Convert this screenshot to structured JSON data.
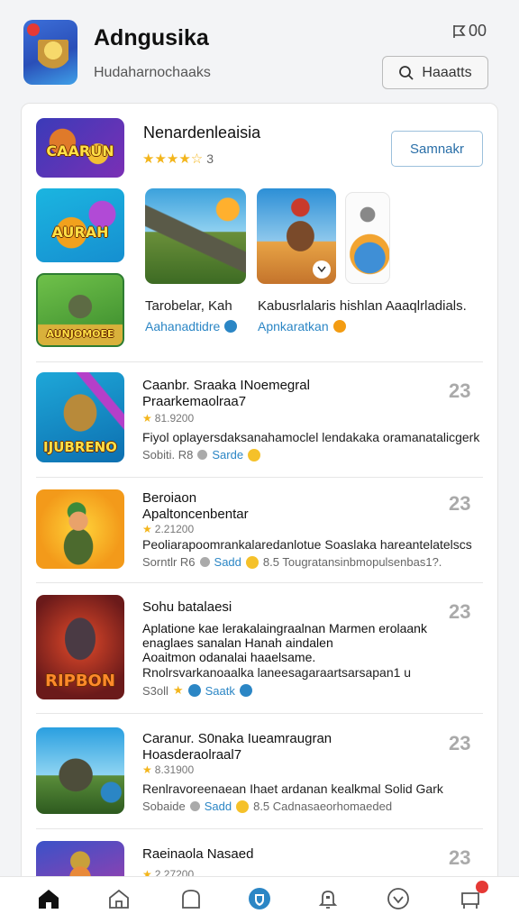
{
  "header": {
    "app_title": "Adngusika",
    "app_subtitle": "Hudaharnochaaks",
    "flag_count": "00",
    "search_label": "Haaatts"
  },
  "featured": {
    "title": "Nenardenleaisia",
    "rating_stars": "★★★★☆",
    "rating_value": "3",
    "action_label": "Samnakr",
    "main_thumb_label": "CAARUN",
    "thumb_a_label": "AURAH",
    "thumb_b_label": "AUNJOMOEE",
    "shot1_caption": "Tarobelar, Kah",
    "shot1_link": "Aahanadtidre",
    "shot2_caption": "Kabusrlalaris hishlan Aaaqlrladials.",
    "shot2_link": "Apnkaratkan"
  },
  "items": [
    {
      "title_line1": "Caanbr. Sraaka INoemegral",
      "title_line2": "Praarkemaolraa7",
      "rating": "81.9200",
      "description": "Fiyol oplayersdaksanahamoclel lendakaka oramanatalicgerk",
      "meta_left": "Sobiti. R8",
      "meta_link": "Sarde",
      "meta_right": "",
      "count": "23",
      "thumb_label": "IJUBRENO"
    },
    {
      "title_line1": "Beroiaon",
      "title_line2": "Apaltoncenbentar",
      "rating": "2.21200",
      "description": "Peoliarapoomrankalaredanlotue Soaslaka hareantelatelscs",
      "meta_left": "Sorntlr R6",
      "meta_link": "Sadd",
      "meta_right": "8.5 Tougratansinbmopulsenbas1?.",
      "count": "23",
      "thumb_label": ""
    },
    {
      "title_line1": "Sohu batalaesi",
      "title_line2": "Aplatione kae lerakalaingraalnan Marmen erolaank",
      "title_line3": "enaglaes sanalan Hanah aindalen",
      "title_line4": "Aoaitmon odanalai haaelsame.",
      "description": "Rnolrsvarkanoaalka laneesagaraartsarsapan1 u",
      "meta_left": "S3oll",
      "meta_link": "Saatk",
      "meta_right": "",
      "count": "23",
      "thumb_label": "RIPBON"
    },
    {
      "title_line1": "Caranur. S0naka Iueamraugran",
      "title_line2": "Hoasderaolraal7",
      "rating": "8.31900",
      "description": "Renlravoreenaean Ihaet ardanan kealkmal Solid Gark",
      "meta_left": "Sobaide",
      "meta_link": "Sadd",
      "meta_right": "8.5 Cadnasaeorhomaeded",
      "count": "23",
      "thumb_label": ""
    },
    {
      "title_line1": "Raeinaola Nasaed",
      "rating": "2.27200",
      "count": "23",
      "thumb_label": ""
    }
  ],
  "nav": {
    "items": [
      "home-icon",
      "house-outline-icon",
      "bag-icon",
      "shield-icon",
      "bell-icon",
      "heart-icon",
      "cart-icon"
    ]
  },
  "colors": {
    "accent": "#2b86c5",
    "star": "#f3b51b",
    "badge": "#e53935"
  }
}
